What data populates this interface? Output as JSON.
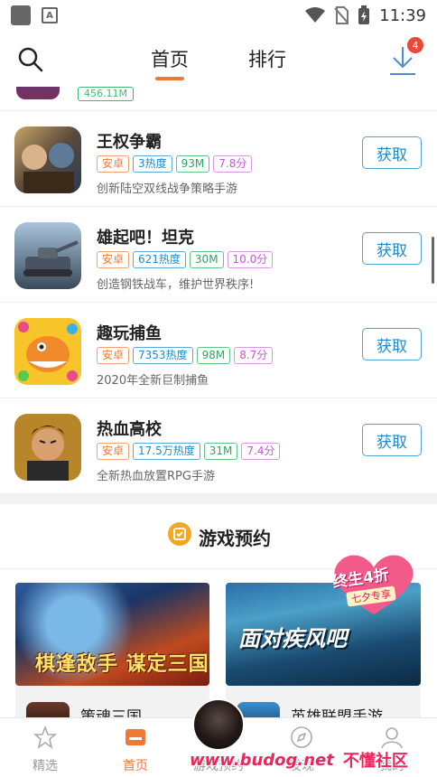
{
  "status_bar": {
    "time": "11:39",
    "notification_icon": "app-notification-square",
    "a_icon_label": "A"
  },
  "header": {
    "tabs": [
      {
        "label": "首页",
        "active": true
      },
      {
        "label": "排行",
        "active": false
      }
    ],
    "download_badge": "4",
    "accent_color": "#f07836"
  },
  "partial_item": {
    "size_tag": "456.11M"
  },
  "apps": [
    {
      "name": "王权争霸",
      "platform": "安卓",
      "heat": "3热度",
      "size": "93M",
      "score": "7.8分",
      "desc": "创新陆空双线战争策略手游",
      "button": "获取"
    },
    {
      "name": "雄起吧！坦克",
      "platform": "安卓",
      "heat": "621热度",
      "size": "30M",
      "score": "10.0分",
      "desc": "创造钢铁战车，维护世界秩序!",
      "button": "获取"
    },
    {
      "name": "趣玩捕鱼",
      "platform": "安卓",
      "heat": "7353热度",
      "size": "98M",
      "score": "8.7分",
      "desc": "2020年全新巨制捕鱼",
      "button": "获取"
    },
    {
      "name": "热血高校",
      "platform": "安卓",
      "heat": "17.5万热度",
      "size": "31M",
      "score": "7.4分",
      "desc": "全新热血放置RPG手游",
      "button": "获取"
    }
  ],
  "reservation": {
    "title": "游戏预约",
    "banners": [
      {
        "art_text": "棋逢敌手 谋定三国",
        "game_name": "策魂三国"
      },
      {
        "art_text": "面对疾风吧",
        "game_name": "英雄联盟手游",
        "promo_main": "终生4折",
        "promo_sub": "七夕专享"
      }
    ]
  },
  "bottom_nav": [
    {
      "label": "精选",
      "icon": "star-icon",
      "active": false
    },
    {
      "label": "首页",
      "icon": "home-icon",
      "active": true
    },
    {
      "label": "游戏预约",
      "icon": "avatar-fab",
      "active": false
    },
    {
      "label": "发现",
      "icon": "compass-icon",
      "active": false
    },
    {
      "label": "我的",
      "icon": "user-icon",
      "active": false
    }
  ],
  "watermark": {
    "url": "www.budog.net",
    "brand": "不懂社区"
  }
}
